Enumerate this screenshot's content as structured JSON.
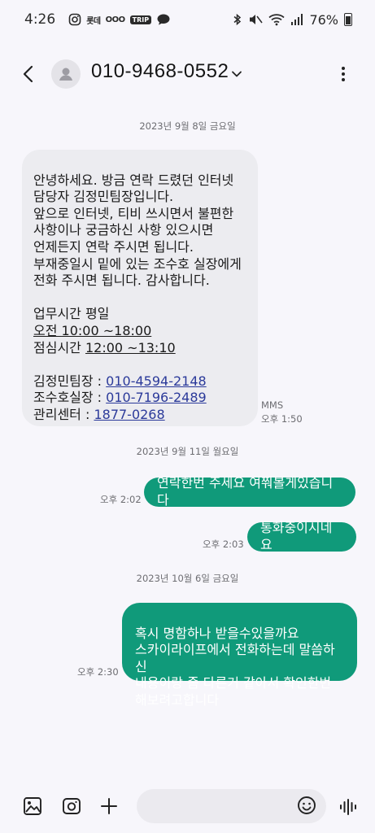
{
  "status_bar": {
    "time": "4:26",
    "app_icons": [
      "instagram-icon",
      "lotte-icon",
      "amex-icon",
      "trip-icon",
      "chat-icon"
    ],
    "lotte_label": "롯데",
    "cards_label": "OOO",
    "trip_label": "TRIP",
    "battery": "76%"
  },
  "header": {
    "contact": "010-9468-0552"
  },
  "messages": {
    "date1": "2023년 9월 8일 금요일",
    "in1": {
      "p1": "안녕하세요. 방금 연락 드렸던 인터넷\n담당자 김정민팀장입니다.\n앞으로 인터넷, 티비 쓰시면서 불편한\n사항이나 궁금하신 사항 있으시면\n언제든지 연락 주시면 됩니다.\n부재중일시 밑에 있는 조수호 실장에게\n전화 주시면 됩니다. 감사합니다.",
      "hours_label": "업무시간 평일",
      "hours_am_prefix": "오전 ",
      "hours_am_time": "10:00 ~18:00",
      "lunch_prefix": "점심시간 ",
      "lunch_time": "12:00 ~13:10",
      "c1_label": "김정민팀장 : ",
      "c1_phone": "010-4594-2148",
      "c2_label": "조수호실장 : ",
      "c2_phone": "010-7196-2489",
      "c3_label": "관리센터 : ",
      "c3_phone": "1877-0268",
      "type": "MMS",
      "time": "오후 1:50"
    },
    "date2": "2023년 9월 11일 월요일",
    "out1": {
      "text": "연락한번 주세요 여쭤볼게있습니다",
      "time": "오후 2:02"
    },
    "out2": {
      "text": "통화중이시네요",
      "time": "오후 2:03"
    },
    "date3": "2023년 10월 6일 금요일",
    "out3": {
      "text": "혹시 명함하나 받을수있을까요\n스카이라이프에서 전화하는데 말씀하신\n내용이랑 좀 다른거 같아서 확인한번\n해보려고합니다",
      "time": "오후 2:30"
    }
  },
  "colors": {
    "accent": "#109a7a",
    "incoming_bubble": "#ececf0",
    "link": "#2b3a9a",
    "background": "#f7f6fb"
  }
}
